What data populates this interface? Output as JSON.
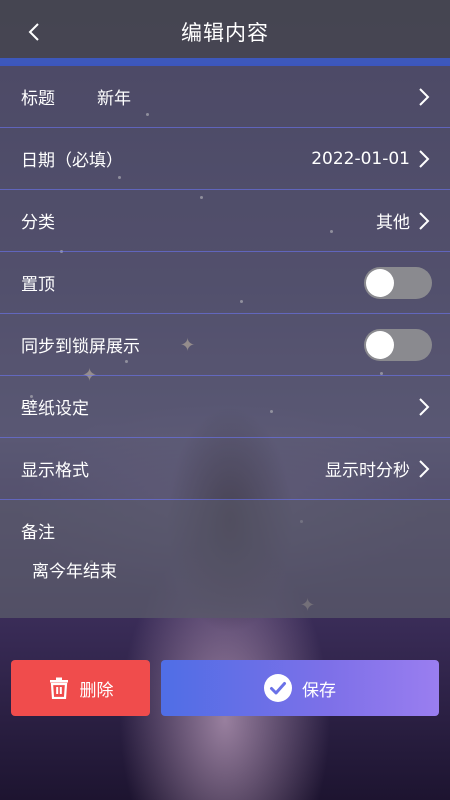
{
  "header": {
    "title": "编辑内容",
    "back_icon": "chevron-left-icon"
  },
  "form": {
    "title_row": {
      "label": "标题",
      "value": "新年"
    },
    "date_row": {
      "label": "日期（必填）",
      "value": "2022-01-01"
    },
    "category_row": {
      "label": "分类",
      "value": "其他"
    },
    "pin_row": {
      "label": "置顶",
      "enabled": false
    },
    "lockscreen_row": {
      "label": "同步到锁屏展示",
      "enabled": false
    },
    "wallpaper_row": {
      "label": "壁纸设定"
    },
    "format_row": {
      "label": "显示格式",
      "value": "显示时分秒"
    },
    "notes": {
      "label": "备注",
      "value": "离今年结束"
    }
  },
  "actions": {
    "delete_label": "删除",
    "save_label": "保存"
  },
  "colors": {
    "delete": "#f04c4c",
    "save_start": "#4f6ee6",
    "save_end": "#9a7ef0",
    "divider": "#6e78ff"
  }
}
